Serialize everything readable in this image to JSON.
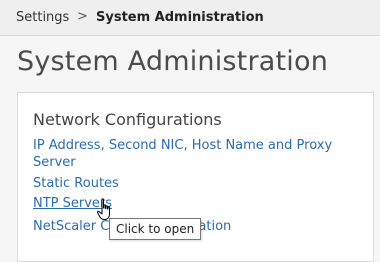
{
  "breadcrumb": {
    "root": "Settings",
    "separator": ">",
    "current": "System Administration"
  },
  "page": {
    "title": "System Administration"
  },
  "card": {
    "title": "Network Configurations",
    "links": [
      "IP Address, Second NIC, Host Name and Proxy Server",
      "Static Routes",
      "NTP Servers",
      "NetScaler Console Information"
    ]
  },
  "tooltip": {
    "text": "Click to open"
  },
  "cursor": {
    "icon": "hand-pointer-icon"
  }
}
